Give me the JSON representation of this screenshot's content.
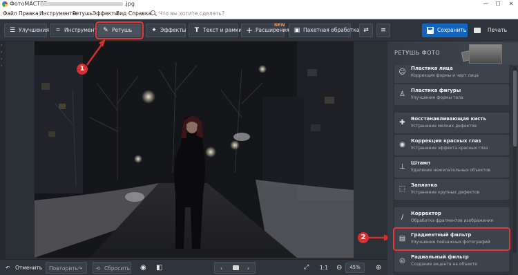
{
  "titlebar": {
    "app_title": "ФотоМАСТЕР",
    "file_ext": ".jpg",
    "minimize": "—",
    "maximize": "☐",
    "close": "✕"
  },
  "menubar": {
    "items": [
      "Файл",
      "Правка",
      "Инструменты",
      "Ретушь",
      "Эффекты",
      "Вид",
      "Справка"
    ],
    "search_placeholder": "Что вы хотите сделать?"
  },
  "toolbar": {
    "buttons": [
      {
        "label": "Улучшения",
        "icon": "sliders-icon"
      },
      {
        "label": "Инструменты",
        "icon": "crop-icon"
      },
      {
        "label": "Ретушь",
        "icon": "brush-icon",
        "active": true
      },
      {
        "label": "Эффекты",
        "icon": "sparkle-icon"
      },
      {
        "label": "Текст и рамки",
        "icon": "text-icon"
      },
      {
        "label": "Расширения",
        "icon": "plus-icon",
        "badge": "NEW"
      },
      {
        "label": "Пакетная обработка",
        "icon": "batch-icon"
      }
    ],
    "save_label": "Сохранить",
    "print_label": "Печать"
  },
  "bottombar": {
    "undo_label": "Отменить",
    "redo_label": "Повторить",
    "reset_label": "Сбросить",
    "ratio_label": "1:1",
    "zoom_value": "45%"
  },
  "panel": {
    "title": "РЕТУШЬ ФОТО",
    "items": [
      {
        "title": "Пластика лица",
        "subtitle": "Коррекция формы и черт лица",
        "icon": "face-icon"
      },
      {
        "title": "Пластика фигуры",
        "subtitle": "Улучшение формы тела",
        "icon": "figure-icon"
      },
      {
        "title": "Восстанавливающая кисть",
        "subtitle": "Устранение мелких дефектов",
        "icon": "healing-brush-icon"
      },
      {
        "title": "Коррекция красных глаз",
        "subtitle": "Устранение эффекта красных глаз",
        "icon": "eye-icon"
      },
      {
        "title": "Штамп",
        "subtitle": "Удаление нежелательных объектов",
        "icon": "stamp-icon"
      },
      {
        "title": "Заплатка",
        "subtitle": "Устранение крупных дефектов",
        "icon": "patch-icon"
      },
      {
        "title": "Корректор",
        "subtitle": "Обработка фрагментов изображения",
        "icon": "corrector-icon"
      },
      {
        "title": "Градиентный фильтр",
        "subtitle": "Улучшение пейзажных фотографий",
        "icon": "gradient-filter-icon",
        "highlighted": true
      },
      {
        "title": "Радиальный фильтр",
        "subtitle": "Создание акцента на объекте",
        "icon": "radial-filter-icon"
      }
    ]
  },
  "annotations": {
    "step1": "1",
    "step2": "2",
    "color": "#d32f2f"
  },
  "colors": {
    "accent": "#1565c0",
    "highlight": "#e53935",
    "new_badge": "#ff8a3d"
  }
}
